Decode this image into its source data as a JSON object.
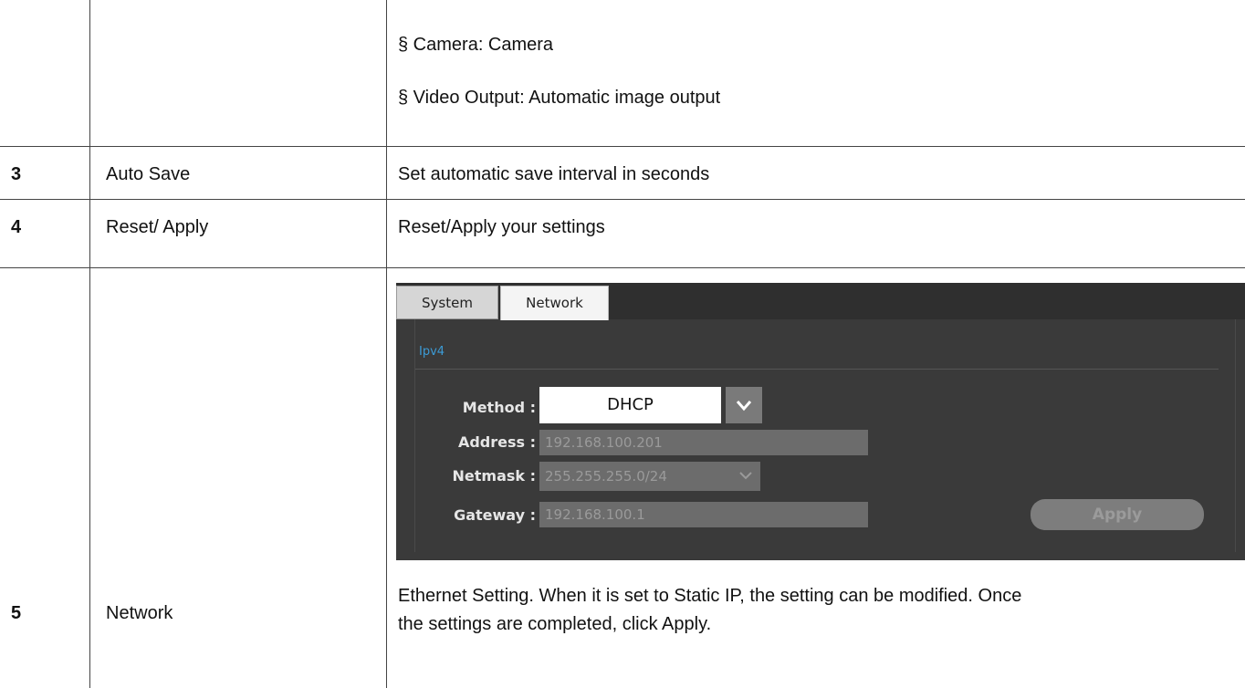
{
  "rows": [
    {
      "number": "",
      "item": "",
      "lines": [
        "§ Camera: Camera",
        "§ Video Output: Automatic image output"
      ]
    },
    {
      "number": "3",
      "item": "Auto Save",
      "description": "Set automatic save interval in seconds"
    },
    {
      "number": "4",
      "item": "Reset/ Apply",
      "description": "Reset/Apply your settings"
    },
    {
      "number": "5",
      "item": "Network",
      "description_line1": "Ethernet Setting. When it is set to Static IP, the setting can be modified. Once",
      "description_line2": "the settings are completed, click Apply."
    }
  ],
  "settings_panel": {
    "tabs": [
      "System",
      "Network"
    ],
    "active_tab": "Network",
    "section": "Ipv4",
    "method_label": "Method :",
    "method_value": "DHCP",
    "address_label": "Address :",
    "address_value": "192.168.100.201",
    "netmask_label": "Netmask :",
    "netmask_value": "255.255.255.0/24",
    "gateway_label": "Gateway :",
    "gateway_value": "192.168.100.1",
    "apply_label": "Apply",
    "dropdown_icon": "chevron-down-icon"
  }
}
